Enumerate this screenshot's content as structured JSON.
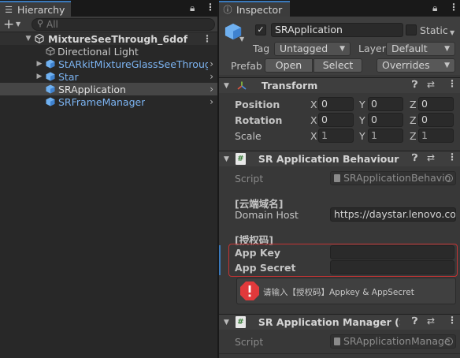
{
  "hierarchy": {
    "tab_label": "Hierarchy",
    "search_placeholder": "All",
    "add_symbol": "+",
    "scene_name": "MixtureSeeThrough_6dof",
    "items": [
      {
        "label": "Directional Light",
        "prefab": false,
        "has_children": false,
        "selected": false
      },
      {
        "label": "StARkitMixtureGlassSeeThrough",
        "prefab": true,
        "has_children": true,
        "selected": false
      },
      {
        "label": "Star",
        "prefab": true,
        "has_children": true,
        "selected": false
      },
      {
        "label": "SRApplication",
        "prefab": true,
        "has_children": false,
        "selected": true
      },
      {
        "label": "SRFrameManager",
        "prefab": true,
        "has_children": false,
        "selected": false
      }
    ]
  },
  "inspector": {
    "tab_label": "Inspector",
    "object_name": "SRApplication",
    "static_label": "Static",
    "tag_label": "Tag",
    "tag_value": "Untagged",
    "layer_label": "Layer",
    "layer_value": "Default",
    "prefab_label": "Prefab",
    "open_label": "Open",
    "select_label": "Select",
    "overrides_label": "Overrides",
    "transform": {
      "title": "Transform",
      "rows": [
        {
          "label": "Position",
          "x": "0",
          "y": "0",
          "z": "0"
        },
        {
          "label": "Rotation",
          "x": "0",
          "y": "0",
          "z": "0"
        },
        {
          "label": "Scale",
          "x": "1",
          "y": "1",
          "z": "1"
        }
      ],
      "axis_x": "X",
      "axis_y": "Y",
      "axis_z": "Z"
    },
    "behaviour": {
      "title": "SR Application Behaviour (Scri",
      "script_label": "Script",
      "script_value": "SRApplicationBehavio",
      "section_domain": "[云端域名]",
      "domain_label": "Domain Host",
      "domain_value": "https://daystar.lenovo.com",
      "section_auth": "[授权码]",
      "appkey_label": "App Key",
      "appkey_value": "",
      "appsecret_label": "App Secret",
      "appsecret_value": "",
      "help_text": "请输入【授权码】Appkey & AppSecret"
    },
    "manager": {
      "title": "SR Application Manager (Scrip",
      "script_label": "Script",
      "script_value": "SRApplicationManage"
    }
  },
  "colors": {
    "accent_blue": "#3a79bb",
    "prefab_blue": "#7cb4f2",
    "error_red": "#e0393b",
    "highlight_red_border": "#c53333"
  }
}
